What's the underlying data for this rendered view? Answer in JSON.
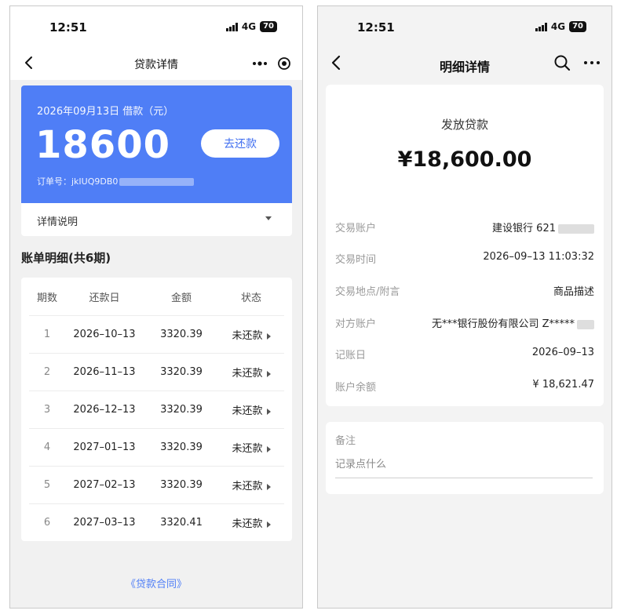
{
  "left": {
    "status": {
      "time": "12:51",
      "network": "4G",
      "battery": "70"
    },
    "nav": {
      "title": "贷款详情"
    },
    "loan": {
      "date_label": "2026年09月13日 借款（元）",
      "amount": "18600",
      "order_label": "订单号：jkIUQ9DB0",
      "repay_label": "去还款"
    },
    "detail_label": "详情说明",
    "bill_heading": "账单明细(共6期)",
    "bill_columns": {
      "period": "期数",
      "date": "还款日",
      "amount": "金额",
      "status": "状态"
    },
    "bills": [
      {
        "period": "1",
        "date": "2026–10–13",
        "amount": "3320.39",
        "status": "未还款"
      },
      {
        "period": "2",
        "date": "2026–11–13",
        "amount": "3320.39",
        "status": "未还款"
      },
      {
        "period": "3",
        "date": "2026–12–13",
        "amount": "3320.39",
        "status": "未还款"
      },
      {
        "period": "4",
        "date": "2027–01–13",
        "amount": "3320.39",
        "status": "未还款"
      },
      {
        "period": "5",
        "date": "2027–02–13",
        "amount": "3320.39",
        "status": "未还款"
      },
      {
        "period": "6",
        "date": "2027–03–13",
        "amount": "3320.41",
        "status": "未还款"
      }
    ],
    "contract_link": "《贷款合同》"
  },
  "right": {
    "status": {
      "time": "12:51",
      "network": "4G",
      "battery": "70"
    },
    "nav": {
      "title": "明细详情"
    },
    "txn": {
      "type": "发放贷款",
      "amount": "¥18,600.00",
      "rows": [
        {
          "key": "交易账户",
          "value": "建设银行 621"
        },
        {
          "key": "交易时间",
          "value": "2026–09–13 11:03:32"
        },
        {
          "key": "交易地点/附言",
          "value": "商品描述"
        },
        {
          "key": "对方账户",
          "value": "无***银行股份有限公司 Z*****"
        },
        {
          "key": "记账日",
          "value": "2026–09–13"
        },
        {
          "key": "账户余额",
          "value": "¥ 18,621.47"
        }
      ]
    },
    "note": {
      "label": "备注",
      "placeholder": "记录点什么"
    }
  }
}
